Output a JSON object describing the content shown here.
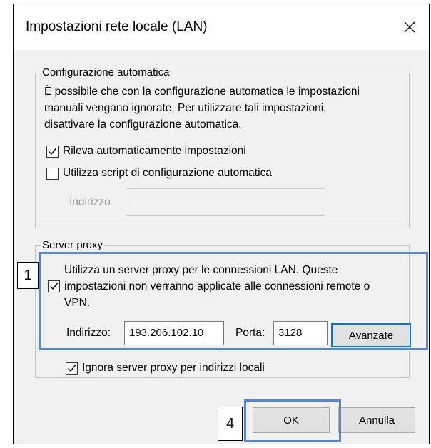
{
  "window": {
    "title": "Impostazioni rete locale (LAN)",
    "close_glyph": "×"
  },
  "auto_config": {
    "group_label": "Configurazione automatica",
    "description_lines": [
      "È possibile che con la configurazione automatica le impostazioni",
      "manuali vengano ignorate. Per utilizzare tali impostazioni,",
      "disattivare la configurazione automatica."
    ],
    "detect_label": "Rileva automaticamente impostazioni",
    "detect_checked": true,
    "script_label": "Utilizza script di configurazione automatica",
    "script_checked": false,
    "address_label": "Indirizzo",
    "address_value": ""
  },
  "proxy": {
    "group_label": "Server proxy",
    "use_proxy_lines": [
      "Utilizza un server proxy per le connessioni LAN. Queste",
      "impostazioni non verranno applicate alle connessioni remote o",
      "VPN."
    ],
    "use_proxy_checked": true,
    "address_label": "Indirizzo:",
    "address_value": "193.206.102.10",
    "port_label": "Porta:",
    "port_value": "3128",
    "advanced_label": "Avanzate",
    "bypass_label": "Ignora server proxy per indirizzi locali",
    "bypass_checked": true
  },
  "buttons": {
    "ok_label": "OK",
    "cancel_label": "Annulla"
  },
  "callouts": {
    "proxy_number": "1",
    "ok_number": "4"
  },
  "colors": {
    "callout_border": "#5b86c1",
    "default_button_border": "#0078d7",
    "dialog_bg": "#f0f0f0"
  },
  "icons": {
    "close": "close-icon",
    "check": "checkmark-icon"
  }
}
